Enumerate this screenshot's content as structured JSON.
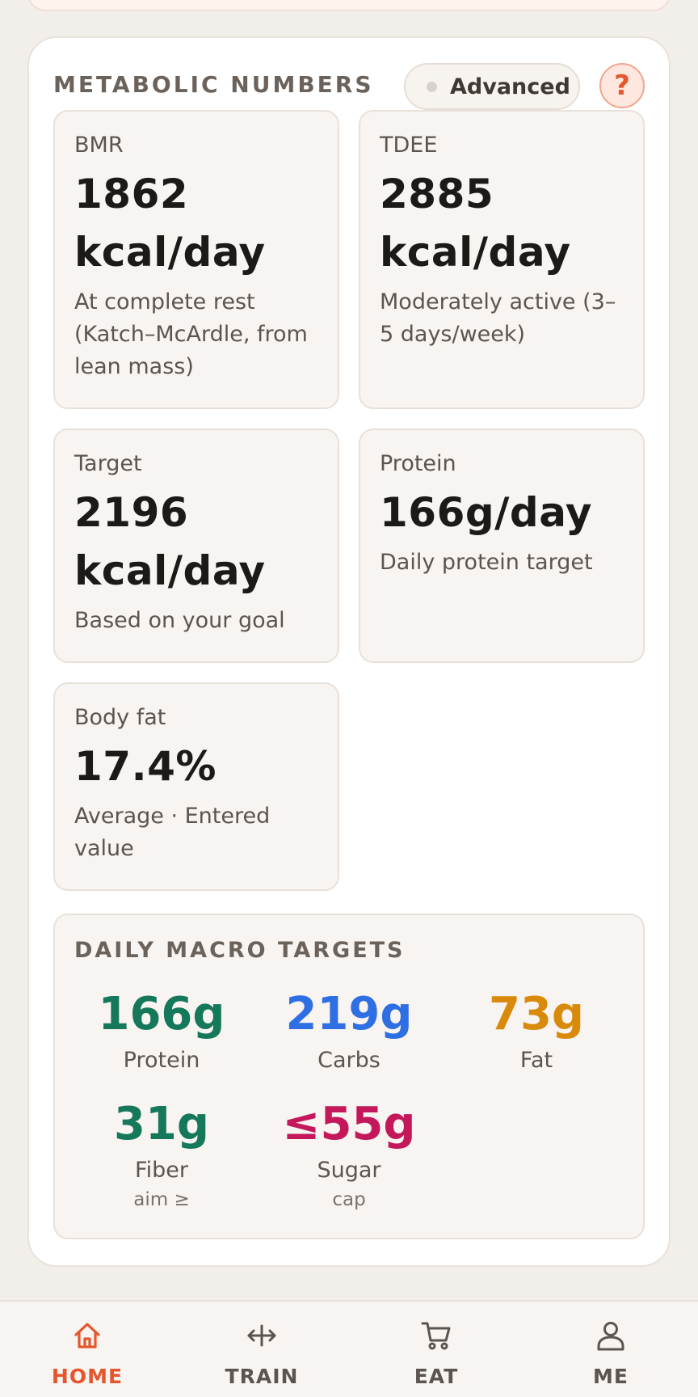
{
  "section": {
    "title": "METABOLIC NUMBERS",
    "advanced_label": "Advanced",
    "help_label": "?"
  },
  "stats": [
    {
      "label": "BMR",
      "value": "1862",
      "unit": "kcal/day",
      "sub": "At complete rest (Katch–McArdle, from lean mass)"
    },
    {
      "label": "TDEE",
      "value": "2885",
      "unit": "kcal/day",
      "sub": "Moderately active (3–5 days/week)"
    },
    {
      "label": "Target",
      "value": "2196",
      "unit": "kcal/day",
      "sub": "Based on your goal"
    },
    {
      "label": "Protein",
      "value": "166g/day",
      "unit": "",
      "sub": "Daily protein target"
    },
    {
      "label": "Body fat",
      "value": "17.4%",
      "unit": "",
      "sub": "Average · Entered value"
    }
  ],
  "macros": {
    "title": "DAILY MACRO TARGETS",
    "items": [
      {
        "value": "166g",
        "name": "Protein",
        "note": "",
        "color": "#15785a"
      },
      {
        "value": "219g",
        "name": "Carbs",
        "note": "",
        "color": "#2f6fe4"
      },
      {
        "value": "73g",
        "name": "Fat",
        "note": "",
        "color": "#d98a0b"
      },
      {
        "value": "31g",
        "name": "Fiber",
        "note": "aim ≥",
        "color": "#15785a"
      },
      {
        "value": "≤55g",
        "name": "Sugar",
        "note": "cap",
        "color": "#c4185a"
      }
    ]
  },
  "nav": {
    "items": [
      {
        "label": "HOME",
        "icon": "home-icon",
        "active": true
      },
      {
        "label": "TRAIN",
        "icon": "move-horizontal-icon",
        "active": false
      },
      {
        "label": "EAT",
        "icon": "cart-icon",
        "active": false
      },
      {
        "label": "ME",
        "icon": "user-icon",
        "active": false
      }
    ]
  },
  "colors": {
    "accent": "#e4572e",
    "protein": "#15785a",
    "carbs": "#2f6fe4",
    "fat": "#d98a0b",
    "sugar": "#c4185a"
  }
}
